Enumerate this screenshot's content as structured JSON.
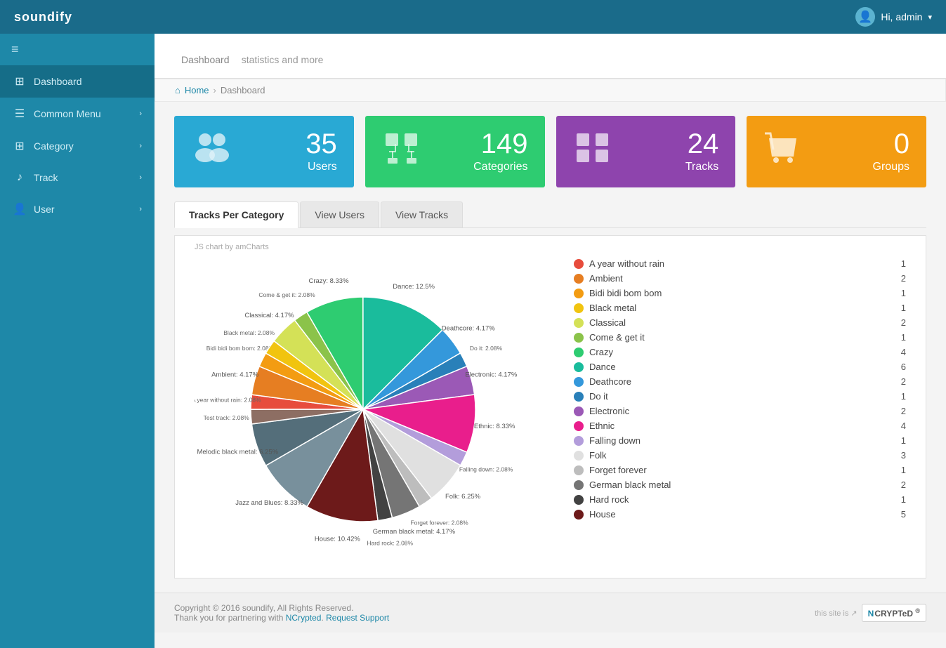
{
  "app": {
    "name": "soundify",
    "user_greeting": "Hi, admin"
  },
  "sidebar": {
    "toggle_icon": "≡",
    "items": [
      {
        "id": "dashboard",
        "label": "Dashboard",
        "icon": "⊞",
        "active": true
      },
      {
        "id": "common-menu",
        "label": "Common Menu",
        "icon": "☰",
        "has_arrow": true
      },
      {
        "id": "category",
        "label": "Category",
        "icon": "⊞",
        "has_arrow": true
      },
      {
        "id": "track",
        "label": "Track",
        "icon": "♪",
        "has_arrow": true
      },
      {
        "id": "user",
        "label": "User",
        "icon": "👤",
        "has_arrow": true
      }
    ]
  },
  "page": {
    "title": "Dashboard",
    "subtitle": "statistics and more",
    "breadcrumb_home": "Home",
    "breadcrumb_current": "Dashboard"
  },
  "stat_cards": [
    {
      "id": "users",
      "number": "35",
      "label": "Users",
      "color": "blue",
      "icon": "👥"
    },
    {
      "id": "categories",
      "number": "149",
      "label": "Categories",
      "color": "green",
      "icon": "⊞"
    },
    {
      "id": "tracks",
      "number": "24",
      "label": "Tracks",
      "color": "purple",
      "icon": "⊞"
    },
    {
      "id": "groups",
      "number": "0",
      "label": "Groups",
      "color": "orange",
      "icon": "🛒"
    }
  ],
  "tabs": [
    {
      "id": "tracks-per-category",
      "label": "Tracks Per Category",
      "active": true
    },
    {
      "id": "view-users",
      "label": "View Users",
      "active": false
    },
    {
      "id": "view-tracks",
      "label": "View Tracks",
      "active": false
    }
  ],
  "chart": {
    "source_label": "JS chart by amCharts",
    "segments": [
      {
        "label": "A year without rain",
        "percent": 2.08,
        "color": "#e74c3c",
        "angle": 0,
        "sweep": 7.5
      },
      {
        "label": "Ambient",
        "percent": 4.17,
        "color": "#e67e22",
        "angle": 7.5,
        "sweep": 15
      },
      {
        "label": "Bidi bidi bom bom",
        "percent": 2.08,
        "color": "#f39c12",
        "angle": 22.5,
        "sweep": 7.5
      },
      {
        "label": "Black metal",
        "percent": 2.08,
        "color": "#f1c40f",
        "angle": 30,
        "sweep": 7.5
      },
      {
        "label": "Classical",
        "percent": 4.17,
        "color": "#d4e157",
        "angle": 37.5,
        "sweep": 15
      },
      {
        "label": "Come & get it",
        "percent": 2.08,
        "color": "#8bc34a",
        "angle": 52.5,
        "sweep": 7.5
      },
      {
        "label": "Crazy",
        "percent": 8.33,
        "color": "#2ecc71",
        "angle": 60,
        "sweep": 30
      },
      {
        "label": "Dance",
        "percent": 12.5,
        "color": "#1abc9c",
        "angle": 90,
        "sweep": 45
      },
      {
        "label": "Deathcore",
        "percent": 4.17,
        "color": "#3498db",
        "angle": 135,
        "sweep": 15
      },
      {
        "label": "Do it",
        "percent": 2.08,
        "color": "#2980b9",
        "angle": 150,
        "sweep": 7.5
      },
      {
        "label": "Electronic",
        "percent": 4.17,
        "color": "#9b59b6",
        "angle": 157.5,
        "sweep": 15
      },
      {
        "label": "Ethnic",
        "percent": 8.33,
        "color": "#e91e8c",
        "angle": 172.5,
        "sweep": 30
      },
      {
        "label": "Falling down",
        "percent": 2.08,
        "color": "#b39ddb",
        "angle": 202.5,
        "sweep": 7.5
      },
      {
        "label": "Folk",
        "percent": 6.25,
        "color": "#e0e0e0",
        "angle": 210,
        "sweep": 22.5
      },
      {
        "label": "Forget forever",
        "percent": 2.08,
        "color": "#bdbdbd",
        "angle": 232.5,
        "sweep": 7.5
      },
      {
        "label": "German black metal",
        "percent": 4.17,
        "color": "#757575",
        "angle": 240,
        "sweep": 15
      },
      {
        "label": "Hard rock",
        "percent": 2.08,
        "color": "#424242",
        "angle": 255,
        "sweep": 7.5
      },
      {
        "label": "House",
        "percent": 10.42,
        "color": "#6d1a1a",
        "angle": 262.5,
        "sweep": 37.5
      },
      {
        "label": "Jazz and Blues",
        "percent": 8.33,
        "color": "#78909c",
        "angle": 300,
        "sweep": 30
      },
      {
        "label": "Melodic black metal",
        "percent": 6.25,
        "color": "#546e7a",
        "angle": 330,
        "sweep": 22.5
      },
      {
        "label": "Test track",
        "percent": 2.08,
        "color": "#8d6e63",
        "angle": 352.5,
        "sweep": 7.5
      }
    ]
  },
  "legend": [
    {
      "label": "A year without rain",
      "count": "1",
      "color": "#e74c3c"
    },
    {
      "label": "Ambient",
      "count": "2",
      "color": "#e67e22"
    },
    {
      "label": "Bidi bidi bom bom",
      "count": "1",
      "color": "#f39c12"
    },
    {
      "label": "Black metal",
      "count": "1",
      "color": "#f1c40f"
    },
    {
      "label": "Classical",
      "count": "2",
      "color": "#d4e157"
    },
    {
      "label": "Come & get it",
      "count": "1",
      "color": "#8bc34a"
    },
    {
      "label": "Crazy",
      "count": "4",
      "color": "#2ecc71"
    },
    {
      "label": "Dance",
      "count": "6",
      "color": "#1abc9c"
    },
    {
      "label": "Deathcore",
      "count": "2",
      "color": "#3498db"
    },
    {
      "label": "Do it",
      "count": "1",
      "color": "#2980b9"
    },
    {
      "label": "Electronic",
      "count": "2",
      "color": "#9b59b6"
    },
    {
      "label": "Ethnic",
      "count": "4",
      "color": "#e91e8c"
    },
    {
      "label": "Falling down",
      "count": "1",
      "color": "#b39ddb"
    },
    {
      "label": "Folk",
      "count": "3",
      "color": "#e0e0e0"
    },
    {
      "label": "Forget forever",
      "count": "1",
      "color": "#bdbdbd"
    },
    {
      "label": "German black metal",
      "count": "2",
      "color": "#757575"
    },
    {
      "label": "Hard rock",
      "count": "1",
      "color": "#424242"
    },
    {
      "label": "House",
      "count": "5",
      "color": "#6d1a1a"
    }
  ],
  "footer": {
    "copyright": "Copyright © 2016 soundify, All Rights Reserved.",
    "thanks": "Thank you for partnering with",
    "ncrypted_link": "NCrypted",
    "support_link": "Request Support",
    "ncrypted_badge": "NCRYPTeD"
  }
}
